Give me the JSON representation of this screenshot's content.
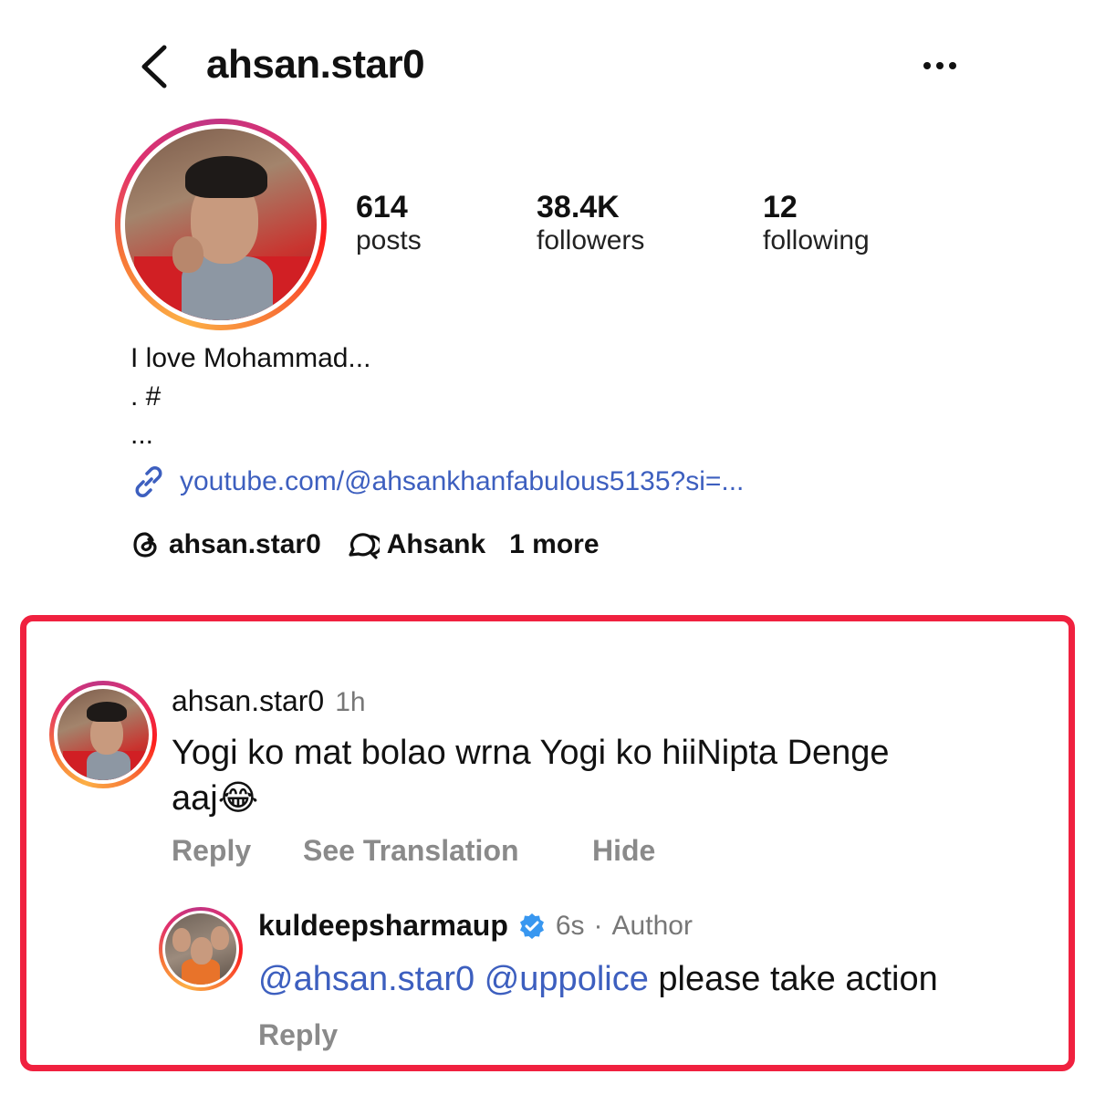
{
  "header": {
    "username": "ahsan.star0",
    "back_icon": "chevron-left-icon",
    "more_icon": "more-horizontal-icon"
  },
  "profile": {
    "stats": [
      {
        "value": "614",
        "label": "posts"
      },
      {
        "value": "38.4K",
        "label": "followers"
      },
      {
        "value": "12",
        "label": "following"
      }
    ],
    "bio": [
      "I love Mohammad...",
      ". #",
      "..."
    ],
    "link": "youtube.com/@ahsankhanfabulous5135?si=...",
    "socials": {
      "threads": "ahsan.star0",
      "second": "Ahsank",
      "more": "1 more"
    }
  },
  "comment": {
    "user": "ahsan.star0",
    "time": "1h",
    "text_line1": "Yogi ko mat bolao wrna Yogi ko hiiNipta Denge",
    "text_line2": "aaj",
    "emoji": "😂",
    "actions": {
      "reply": "Reply",
      "translate": "See Translation",
      "hide": "Hide"
    }
  },
  "reply": {
    "user": "kuldeepsharmaup",
    "time": "6s",
    "separator": "·",
    "role": "Author",
    "mention1": "@ahsan.star0",
    "mention2": "@uppolice",
    "text": "please take action",
    "action": "Reply"
  },
  "colors": {
    "highlight": "#f0213f",
    "link": "#3d5fbf",
    "verified": "#3897f0"
  }
}
